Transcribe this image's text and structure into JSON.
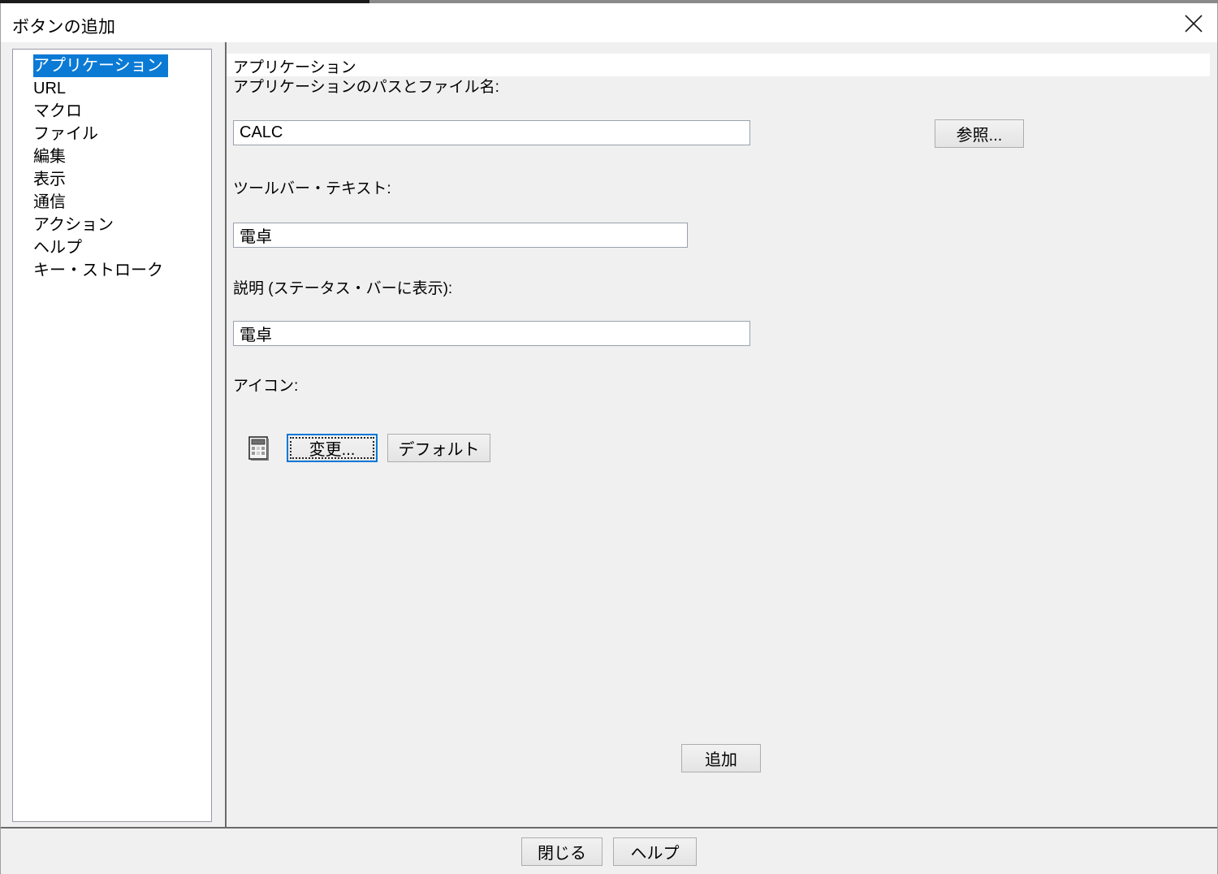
{
  "window": {
    "title": "ボタンの追加",
    "close_icon": "close-icon"
  },
  "categories": {
    "items": [
      {
        "label": "アプリケーション",
        "selected": true
      },
      {
        "label": "URL",
        "selected": false
      },
      {
        "label": "マクロ",
        "selected": false
      },
      {
        "label": "ファイル",
        "selected": false
      },
      {
        "label": "編集",
        "selected": false
      },
      {
        "label": "表示",
        "selected": false
      },
      {
        "label": "通信",
        "selected": false
      },
      {
        "label": "アクション",
        "selected": false
      },
      {
        "label": "ヘルプ",
        "selected": false
      },
      {
        "label": "キー・ストローク",
        "selected": false
      }
    ]
  },
  "panel": {
    "section_title": "アプリケーション",
    "path_label": "アプリケーションのパスとファイル名:",
    "path_value": "CALC",
    "path_placeholder": "",
    "browse_button": "参照...",
    "toolbar_text_label": "ツールバー・テキスト:",
    "toolbar_text_value": "電卓",
    "toolbar_text_placeholder": "",
    "description_label": "説明 (ステータス・バーに表示):",
    "description_value": "電卓",
    "description_placeholder": "",
    "icon_label": "アイコン:",
    "icon_preview_name": "calculator-icon",
    "change_icon_button": "変更...",
    "default_icon_button": "デフォルト",
    "add_button": "追加"
  },
  "footer": {
    "close_button": "閉じる",
    "help_button": "ヘルプ"
  },
  "colors": {
    "selection": "#0b7ad5",
    "focus": "#0078d7",
    "dialog_bg": "#f0f0f0",
    "field_bg": "#ffffff"
  }
}
